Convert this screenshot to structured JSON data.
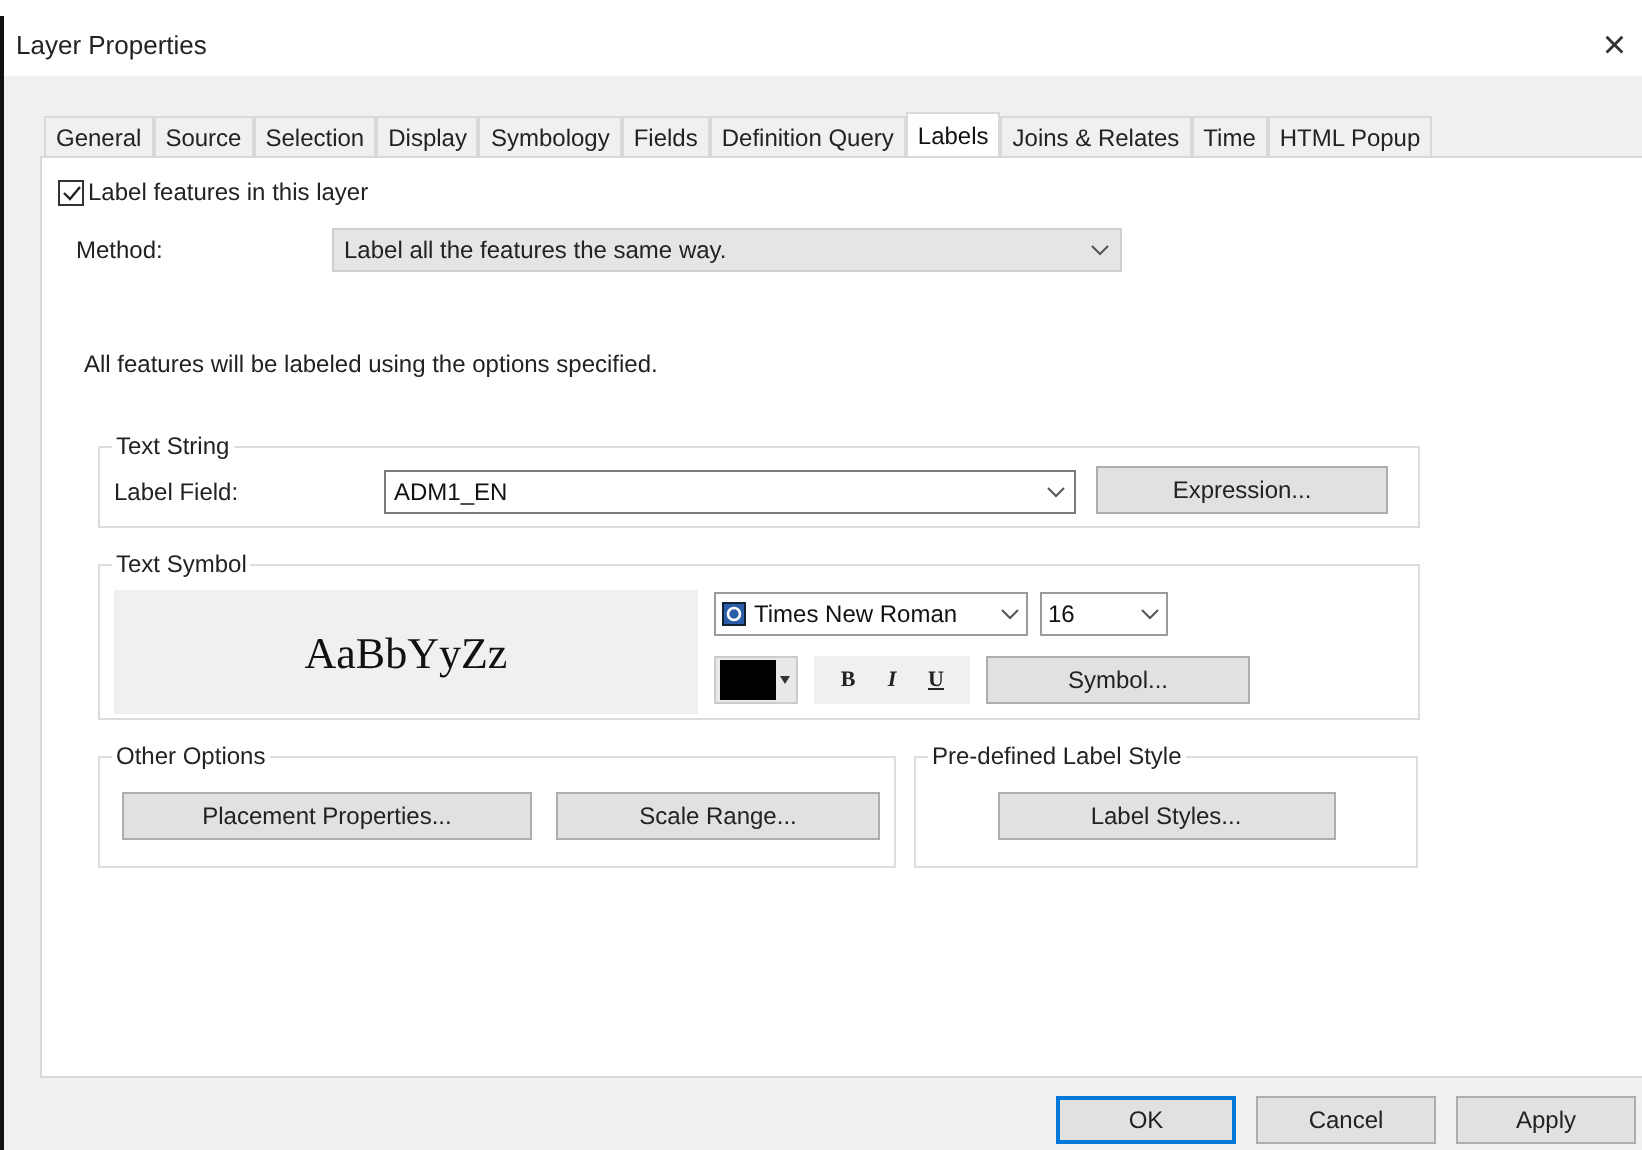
{
  "window": {
    "title": "Layer Properties",
    "close": "×"
  },
  "tabs": [
    {
      "label": "General",
      "selected": false
    },
    {
      "label": "Source",
      "selected": false
    },
    {
      "label": "Selection",
      "selected": false
    },
    {
      "label": "Display",
      "selected": false
    },
    {
      "label": "Symbology",
      "selected": false
    },
    {
      "label": "Fields",
      "selected": false
    },
    {
      "label": "Definition Query",
      "selected": false
    },
    {
      "label": "Labels",
      "selected": true
    },
    {
      "label": "Joins & Relates",
      "selected": false
    },
    {
      "label": "Time",
      "selected": false
    },
    {
      "label": "HTML Popup",
      "selected": false
    }
  ],
  "label_features": {
    "label": "Label features in this layer",
    "checked": true
  },
  "method": {
    "label": "Method:",
    "value": "Label all the features the same way."
  },
  "description": "All features will be labeled using the options specified.",
  "text_string": {
    "title": "Text String",
    "label": "Label Field:",
    "value": "ADM1_EN",
    "button": "Expression..."
  },
  "text_symbol": {
    "title": "Text Symbol",
    "preview": "AaBbYyZz",
    "font": "Times New Roman",
    "size": "16",
    "color": "#000000",
    "styles": [
      {
        "label": "B",
        "kind": "bold"
      },
      {
        "label": "I",
        "kind": "italic"
      },
      {
        "label": "U",
        "kind": "underline"
      }
    ],
    "button": "Symbol..."
  },
  "other_options": {
    "title": "Other Options",
    "buttons": [
      "Placement Properties...",
      "Scale Range..."
    ]
  },
  "predefined": {
    "title": "Pre-defined Label Style",
    "button": "Label Styles..."
  },
  "buttons": [
    {
      "label": "OK",
      "selected": true
    },
    {
      "label": "Cancel",
      "selected": false
    },
    {
      "label": "Apply",
      "selected": false
    }
  ]
}
